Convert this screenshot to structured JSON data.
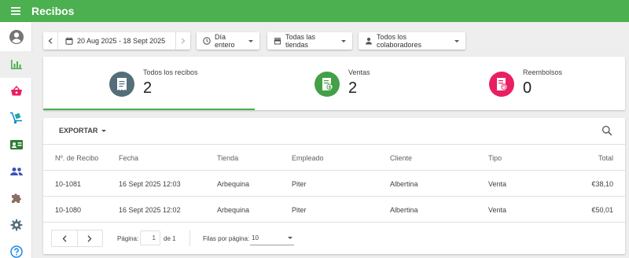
{
  "app": {
    "title": "Recibos"
  },
  "colors": {
    "primary": "#4caf50",
    "receipts": "#546e7a",
    "sales": "#43a047",
    "refunds": "#e91e63"
  },
  "sidebar": {
    "items": [
      {
        "icon": "account-circle-icon"
      },
      {
        "icon": "bar-chart-icon",
        "active": true
      },
      {
        "icon": "basket-icon"
      },
      {
        "icon": "dolly-icon"
      },
      {
        "icon": "id-card-icon"
      },
      {
        "icon": "people-icon"
      },
      {
        "icon": "puzzle-icon"
      },
      {
        "icon": "gear-icon"
      },
      {
        "icon": "help-icon"
      }
    ]
  },
  "filters": {
    "date_range": "20 Aug 2025 - 18 Sept 2025",
    "time": "Día entero",
    "stores": "Todas las tiendas",
    "employees": "Todos los colaboradores"
  },
  "summary": {
    "all": {
      "label": "Todos los recibos",
      "value": "2"
    },
    "sales": {
      "label": "Ventas",
      "value": "2"
    },
    "refunds": {
      "label": "Reembolsos",
      "value": "0"
    }
  },
  "table": {
    "export_label": "EXPORTAR",
    "headers": {
      "receipt": "Nº. de Recibo",
      "date": "Fecha",
      "store": "Tienda",
      "employee": "Empleado",
      "customer": "Cliente",
      "type": "Tipo",
      "total": "Total"
    },
    "rows": [
      {
        "receipt": "10-1081",
        "date": "16 Sept 2025 12:03",
        "store": "Arbequina",
        "employee": "Piter",
        "customer": "Albertina",
        "type": "Venta",
        "total": "€38,10"
      },
      {
        "receipt": "10-1080",
        "date": "16 Sept 2025 12:02",
        "store": "Arbequina",
        "employee": "Piter",
        "customer": "Albertina",
        "type": "Venta",
        "total": "€50,01"
      }
    ]
  },
  "pagination": {
    "page_label": "Página:",
    "page_value": "1",
    "of_label": "de 1",
    "rows_label": "Filas por página:",
    "rows_value": "10"
  }
}
